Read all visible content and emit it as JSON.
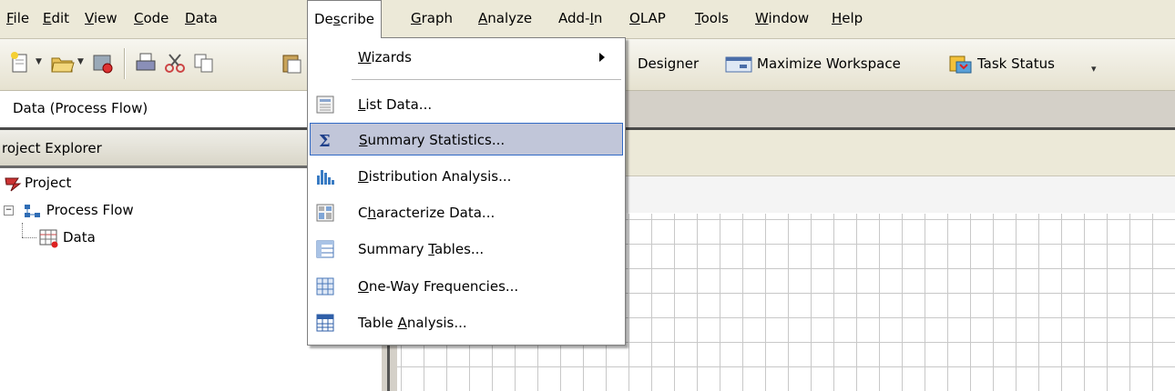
{
  "menubar": {
    "file": "File",
    "edit": "Edit",
    "view": "View",
    "code": "Code",
    "data": "Data",
    "describe": "Describe",
    "graph": "Graph",
    "analyze": "Analyze",
    "addin": "Add-In",
    "olap": "OLAP",
    "tools": "Tools",
    "window": "Window",
    "help": "Help"
  },
  "toolbar": {
    "designer_label": "Designer",
    "maximize_label": "Maximize Workspace",
    "task_status_label": "Task Status"
  },
  "address": {
    "value": "Data (Process Flow)"
  },
  "explorer": {
    "title": "roject Explorer",
    "project": "Project",
    "process_flow": "Process Flow",
    "data": "Data"
  },
  "describe_menu": {
    "items": [
      {
        "label": "Wizards",
        "icon": "none"
      },
      {
        "label": "List Data...",
        "icon": "list-data-icon"
      },
      {
        "label": "Summary Statistics...",
        "icon": "sigma-icon"
      },
      {
        "label": "Distribution Analysis...",
        "icon": "histogram-icon"
      },
      {
        "label": "Characterize Data...",
        "icon": "characterize-icon"
      },
      {
        "label": "Summary Tables...",
        "icon": "summary-table-icon"
      },
      {
        "label": "One-Way Frequencies...",
        "icon": "frequency-table-icon"
      },
      {
        "label": "Table Analysis...",
        "icon": "table-analysis-icon"
      }
    ],
    "highlighted": "Summary Statistics..."
  },
  "colors": {
    "menubar_bg": "#ece9d8",
    "highlight_bg": "#c1c6d9",
    "highlight_border": "#316ac5"
  }
}
